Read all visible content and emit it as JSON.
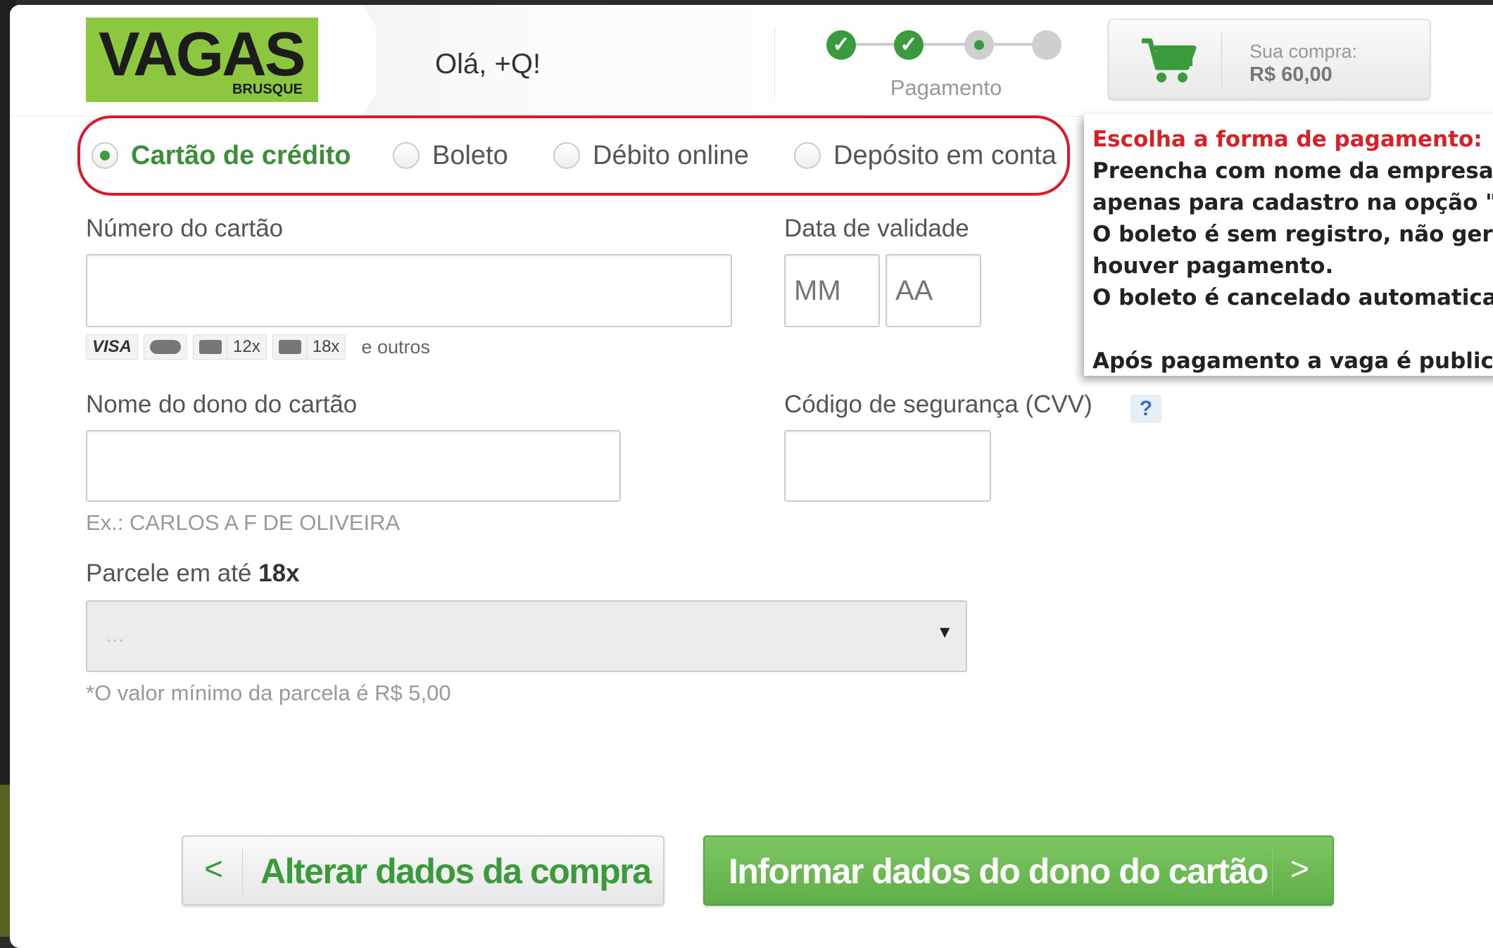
{
  "header": {
    "logo_text": "VAGAS",
    "logo_sub": "BRUSQUE",
    "greeting": "Olá, +Q!",
    "step_label": "Pagamento",
    "cart_label": "Sua compra:",
    "cart_value": "R$ 60,00"
  },
  "payment": {
    "options": [
      {
        "label": "Cartão de crédito",
        "selected": true
      },
      {
        "label": "Boleto",
        "selected": false
      },
      {
        "label": "Débito online",
        "selected": false
      },
      {
        "label": "Depósito em conta",
        "selected": false
      }
    ],
    "highlight_color": "#d81a2a"
  },
  "tooltip": {
    "title": "Escolha a forma de pagamento:",
    "lines": [
      "Preencha com nome da empresa",
      "apenas para cadastro na opção \"",
      "O boleto é sem registro, não ger",
      "houver pagamento.",
      "O boleto é cancelado automatica",
      "Após pagamento a vaga é public"
    ]
  },
  "form": {
    "card_number_label": "Número do cartão",
    "expiry_label": "Data de validade",
    "expiry_month_placeholder": "MM",
    "expiry_year_placeholder": "AA",
    "card_badges": [
      "VISA",
      "12x",
      "18x"
    ],
    "others_text": "e outros",
    "owner_label": "Nome do dono do cartão",
    "owner_hint": "Ex.: CARLOS A F DE OLIVEIRA",
    "cvv_label": "Código de segurança (CVV)",
    "cvv_help": "?",
    "installments_label": "Parcele em até",
    "installments_max": "18x",
    "installments_value": "...",
    "installments_note": "*O valor mínimo da parcela é R$ 5,00"
  },
  "actions": {
    "back_label": "Alterar dados da compra",
    "back_arrow": "<",
    "next_label": "Informar dados do dono do cartão",
    "next_arrow": ">"
  },
  "colors": {
    "brand_green": "#8dc63f",
    "accent_green": "#3b9a3b",
    "alert_red": "#d62128"
  }
}
